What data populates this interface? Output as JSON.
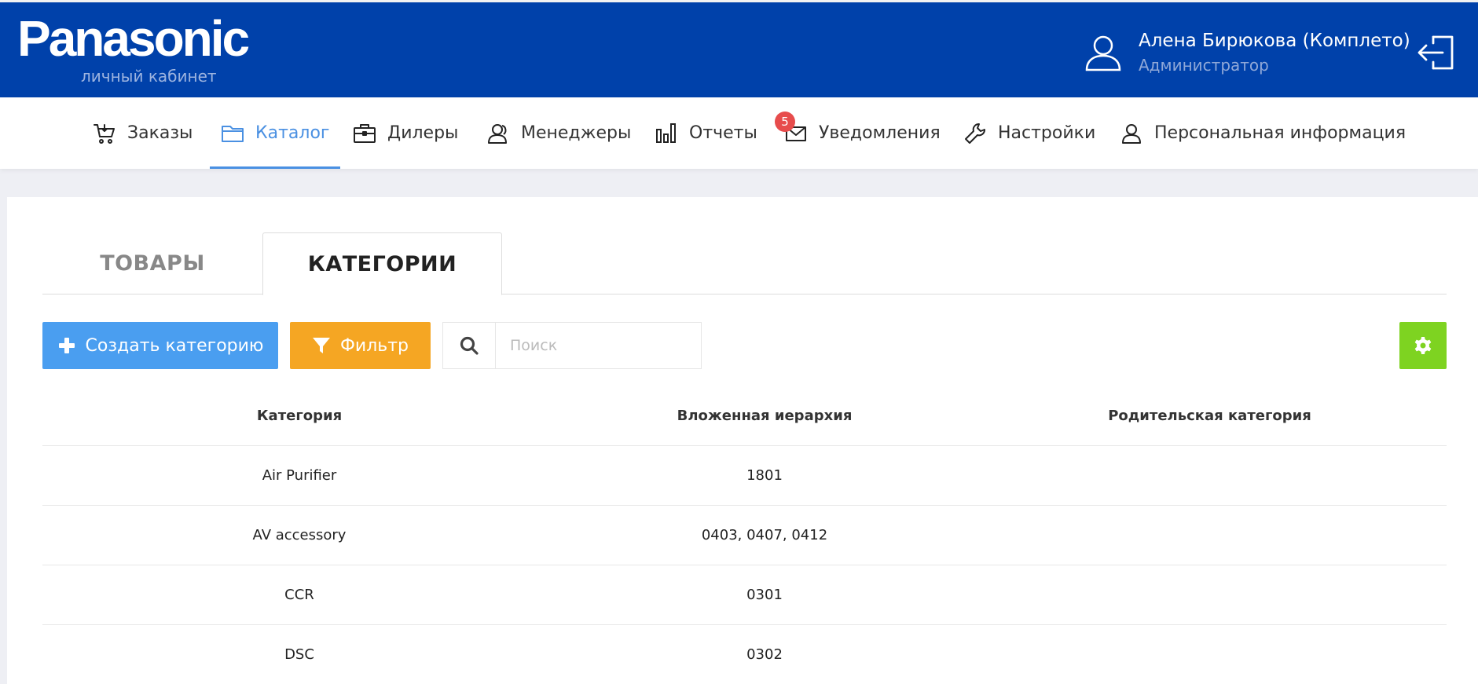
{
  "header": {
    "logo": "Panasonic",
    "logo_sub": "личный кабинет",
    "user_name": "Алена Бирюкова (Комплето)",
    "user_role": "Администратор"
  },
  "nav": {
    "items": [
      {
        "label": "Заказы",
        "icon": "cart-icon"
      },
      {
        "label": "Каталог",
        "icon": "folder-icon",
        "active": true
      },
      {
        "label": "Дилеры",
        "icon": "briefcase-icon"
      },
      {
        "label": "Менеджеры",
        "icon": "users-icon"
      },
      {
        "label": "Отчеты",
        "icon": "bar-chart-icon"
      },
      {
        "label": "Уведомления",
        "icon": "envelope-icon",
        "badge": "5"
      },
      {
        "label": "Настройки",
        "icon": "wrench-icon"
      },
      {
        "label": "Персональная информация",
        "icon": "person-icon"
      }
    ]
  },
  "tabs": {
    "goods": "ТОВАРЫ",
    "categories": "КАТЕГОРИИ"
  },
  "toolbar": {
    "create_label": "Создать категорию",
    "filter_label": "Фильтр",
    "search_placeholder": "Поиск",
    "search_value": ""
  },
  "table": {
    "columns": [
      "Категория",
      "Вложенная иерархия",
      "Родительская категория"
    ],
    "rows": [
      [
        "Air Purifier",
        "1801",
        ""
      ],
      [
        "AV accessory",
        "0403, 0407, 0412",
        ""
      ],
      [
        "CCR",
        "0301",
        ""
      ],
      [
        "DSC",
        "0302",
        ""
      ]
    ]
  },
  "colors": {
    "header_bg": "#0041aa",
    "accent": "#4a90e2",
    "create_button": "#4a9ef0",
    "filter_button": "#f5a623",
    "settings_button": "#7ed321",
    "badge": "#e74c4c"
  }
}
